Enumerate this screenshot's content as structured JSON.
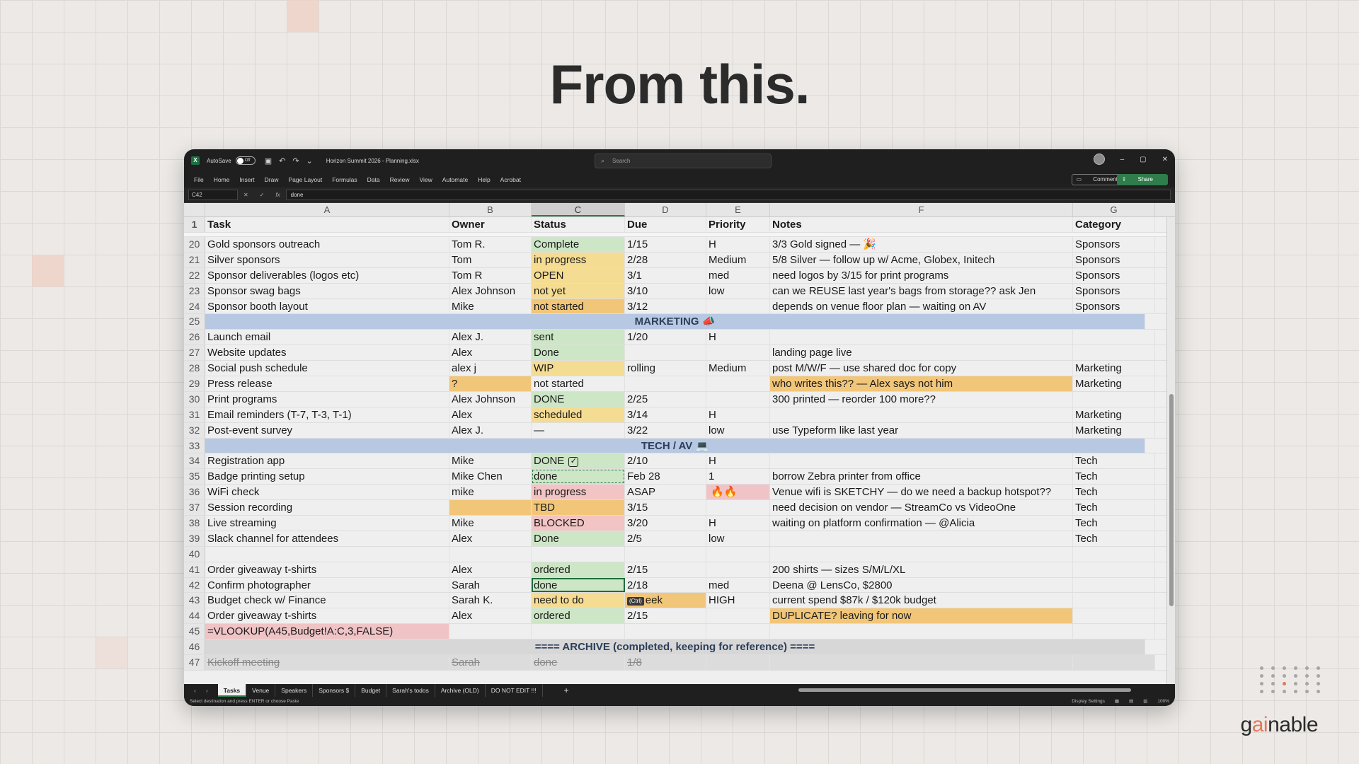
{
  "headline": "From this.",
  "brand": {
    "name_pre": "g",
    "name_ai": "ai",
    "name_post": "nable"
  },
  "window": {
    "autosave_label": "AutoSave",
    "autosave_state": "Off",
    "doc_title": "Horizon Summit 2026 - Planning.xlsx",
    "search_placeholder": "Search",
    "menu": [
      "File",
      "Home",
      "Insert",
      "Draw",
      "Page Layout",
      "Formulas",
      "Data",
      "Review",
      "View",
      "Automate",
      "Help",
      "Acrobat"
    ],
    "comments_label": "Comments",
    "share_label": "Share",
    "name_box": "C42",
    "formula_value": "done"
  },
  "columns": [
    "A",
    "B",
    "C",
    "D",
    "E",
    "F",
    "G"
  ],
  "header_row": {
    "num": "1",
    "cells": [
      "Task",
      "Owner",
      "Status",
      "Due",
      "Priority",
      "Notes",
      "Category"
    ]
  },
  "rows": [
    {
      "num": "20",
      "cells": [
        "Gold sponsors outreach",
        "Tom R.",
        "Complete",
        "1/15",
        "H",
        "3/3 Gold signed — 🎉",
        "Sponsors"
      ],
      "fills": [
        "",
        "",
        "green",
        "",
        "",
        "",
        ""
      ]
    },
    {
      "num": "21",
      "cells": [
        "Silver sponsors",
        "Tom",
        "in progress",
        "2/28",
        "Medium",
        "5/8 Silver — follow up w/ Acme, Globex, Initech",
        "Sponsors"
      ],
      "fills": [
        "",
        "",
        "yellow",
        "",
        "",
        "",
        ""
      ]
    },
    {
      "num": "22",
      "cells": [
        "Sponsor deliverables (logos etc)",
        "Tom R",
        "OPEN",
        "3/1",
        "med",
        "need logos by 3/15 for print programs",
        "Sponsors"
      ],
      "fills": [
        "",
        "",
        "yellow",
        "",
        "",
        "",
        ""
      ]
    },
    {
      "num": "23",
      "cells": [
        "Sponsor swag bags",
        "Alex Johnson",
        "not yet",
        "3/10",
        "low",
        "can we REUSE last year's bags from storage?? ask Jen",
        "Sponsors"
      ],
      "fills": [
        "",
        "",
        "yellow",
        "",
        "",
        "",
        ""
      ]
    },
    {
      "num": "24",
      "cells": [
        "Sponsor booth layout",
        "Mike",
        "not started",
        "3/12",
        "",
        "depends on venue floor plan — waiting on AV",
        "Sponsors"
      ],
      "fills": [
        "",
        "",
        "orange",
        "",
        "",
        "",
        ""
      ]
    },
    {
      "num": "25",
      "section": "MARKETING 📣"
    },
    {
      "num": "26",
      "cells": [
        "Launch email",
        "Alex J.",
        "sent",
        "1/20",
        "H",
        "",
        ""
      ],
      "fills": [
        "",
        "",
        "green",
        "",
        "",
        "",
        ""
      ]
    },
    {
      "num": "27",
      "cells": [
        "Website updates",
        "Alex",
        "Done",
        "",
        "",
        "landing page live",
        ""
      ],
      "fills": [
        "",
        "",
        "green",
        "",
        "",
        "",
        ""
      ]
    },
    {
      "num": "28",
      "cells": [
        "Social push schedule",
        "alex j",
        "WIP",
        "rolling",
        "Medium",
        "post M/W/F — use shared doc for copy",
        "Marketing"
      ],
      "fills": [
        "",
        "",
        "yellow",
        "",
        "",
        "",
        ""
      ]
    },
    {
      "num": "29",
      "cells": [
        "Press release",
        "?",
        "not started",
        "",
        "",
        "who writes this?? — Alex says not him",
        "Marketing"
      ],
      "fills": [
        "",
        "orange",
        "",
        "",
        "",
        "orange",
        ""
      ]
    },
    {
      "num": "30",
      "cells": [
        "Print programs",
        "Alex Johnson",
        "DONE",
        "2/25",
        "",
        "300 printed — reorder 100 more??",
        ""
      ],
      "fills": [
        "",
        "",
        "green",
        "",
        "",
        "",
        ""
      ]
    },
    {
      "num": "31",
      "cells": [
        "Email reminders (T-7, T-3, T-1)",
        "Alex",
        "scheduled",
        "3/14",
        "H",
        "",
        "Marketing"
      ],
      "fills": [
        "",
        "",
        "yellow",
        "",
        "",
        "",
        ""
      ]
    },
    {
      "num": "32",
      "cells": [
        "Post-event survey",
        "Alex J.",
        "—",
        "3/22",
        "low",
        "use Typeform like last year",
        "Marketing"
      ],
      "fills": [
        "",
        "",
        "",
        "",
        "",
        "",
        ""
      ]
    },
    {
      "num": "33",
      "section": "TECH / AV 💻"
    },
    {
      "num": "34",
      "cells": [
        "Registration app",
        "Mike",
        "DONE",
        "2/10",
        "H",
        "",
        "Tech"
      ],
      "fills": [
        "",
        "",
        "green",
        "",
        "",
        "",
        ""
      ],
      "status_icon": "☑"
    },
    {
      "num": "35",
      "cells": [
        "Badge printing setup",
        "Mike Chen",
        "done",
        "Feb 28",
        "1",
        "borrow Zebra printer from office",
        "Tech"
      ],
      "fills": [
        "",
        "",
        "green",
        "",
        "",
        "",
        ""
      ],
      "dashed": true
    },
    {
      "num": "36",
      "cells": [
        "WiFi check",
        "mike",
        "in progress",
        "ASAP",
        "",
        "Venue wifi is SKETCHY — do we need a backup hotspot??",
        "Tech"
      ],
      "fills": [
        "",
        "",
        "red",
        "",
        "pink",
        "",
        ""
      ],
      "priority_icons": "🔥🔥"
    },
    {
      "num": "37",
      "cells": [
        "Session recording",
        "",
        "TBD",
        "3/15",
        "",
        "need decision on vendor — StreamCo vs VideoOne",
        "Tech"
      ],
      "fills": [
        "",
        "orange",
        "orange",
        "",
        "",
        "",
        ""
      ]
    },
    {
      "num": "38",
      "cells": [
        "Live streaming",
        "Mike",
        "BLOCKED",
        "3/20",
        "H",
        "waiting on platform confirmation — @Alicia",
        "Tech"
      ],
      "fills": [
        "",
        "",
        "red",
        "",
        "",
        "",
        ""
      ]
    },
    {
      "num": "39",
      "cells": [
        "Slack channel for attendees",
        "Alex",
        "Done",
        "2/5",
        "low",
        "",
        "Tech"
      ],
      "fills": [
        "",
        "",
        "green",
        "",
        "",
        "",
        ""
      ]
    },
    {
      "num": "40",
      "cells": [
        "",
        "",
        "",
        "",
        "",
        "",
        ""
      ],
      "fills": [
        "",
        "",
        "",
        "",
        "",
        "",
        ""
      ]
    },
    {
      "num": "41",
      "cells": [
        "Order giveaway t-shirts",
        "Alex",
        "ordered",
        "2/15",
        "",
        "200 shirts — sizes S/M/L/XL",
        ""
      ],
      "fills": [
        "",
        "",
        "green",
        "",
        "",
        "",
        ""
      ]
    },
    {
      "num": "42",
      "cells": [
        "Confirm photographer",
        "Sarah",
        "done",
        "2/18",
        "med",
        "Deena @ LensCo, $2800",
        ""
      ],
      "fills": [
        "",
        "",
        "green",
        "",
        "",
        "",
        ""
      ],
      "active": true
    },
    {
      "num": "43",
      "cells": [
        "Budget check w/ Finance",
        "Sarah K.",
        "need to do",
        "eek",
        "HIGH",
        "current spend $87k / $120k budget",
        ""
      ],
      "fills": [
        "",
        "",
        "yellow",
        "orange",
        "",
        "",
        ""
      ],
      "paste_chip": "(Ctrl)"
    },
    {
      "num": "44",
      "cells": [
        "Order giveaway t-shirts",
        "Alex",
        "ordered",
        "2/15",
        "",
        "DUPLICATE? leaving for now",
        ""
      ],
      "fills": [
        "",
        "",
        "green",
        "",
        "",
        "orange",
        ""
      ]
    },
    {
      "num": "45",
      "cells": [
        "=VLOOKUP(A45,Budget!A:C,3,FALSE)",
        "",
        "",
        "",
        "",
        "",
        ""
      ],
      "fills": [
        "pink",
        "",
        "",
        "",
        "",
        "",
        ""
      ]
    },
    {
      "num": "46",
      "archive": "==== ARCHIVE (completed, keeping for reference) ===="
    },
    {
      "num": "47",
      "cells": [
        "Kickoff meeting",
        "Sarah",
        "done",
        "1/8",
        "",
        "",
        ""
      ],
      "strike": true
    }
  ],
  "fill_colors": {
    "green": "#cde6c6",
    "yellow": "#f5dc93",
    "orange": "#f2c679",
    "red": "#f2c4c4",
    "pink": "#f0c4c6"
  },
  "sheet_tabs": [
    "Tasks",
    "Venue",
    "Speakers",
    "Sponsors $",
    "Budget",
    "Sarah's todos",
    "Archive (OLD)",
    "DO NOT EDIT !!!"
  ],
  "active_tab": "Tasks",
  "status_message": "Select destination and press ENTER or choose Paste",
  "display_settings": "Display Settings",
  "zoom": "100%"
}
